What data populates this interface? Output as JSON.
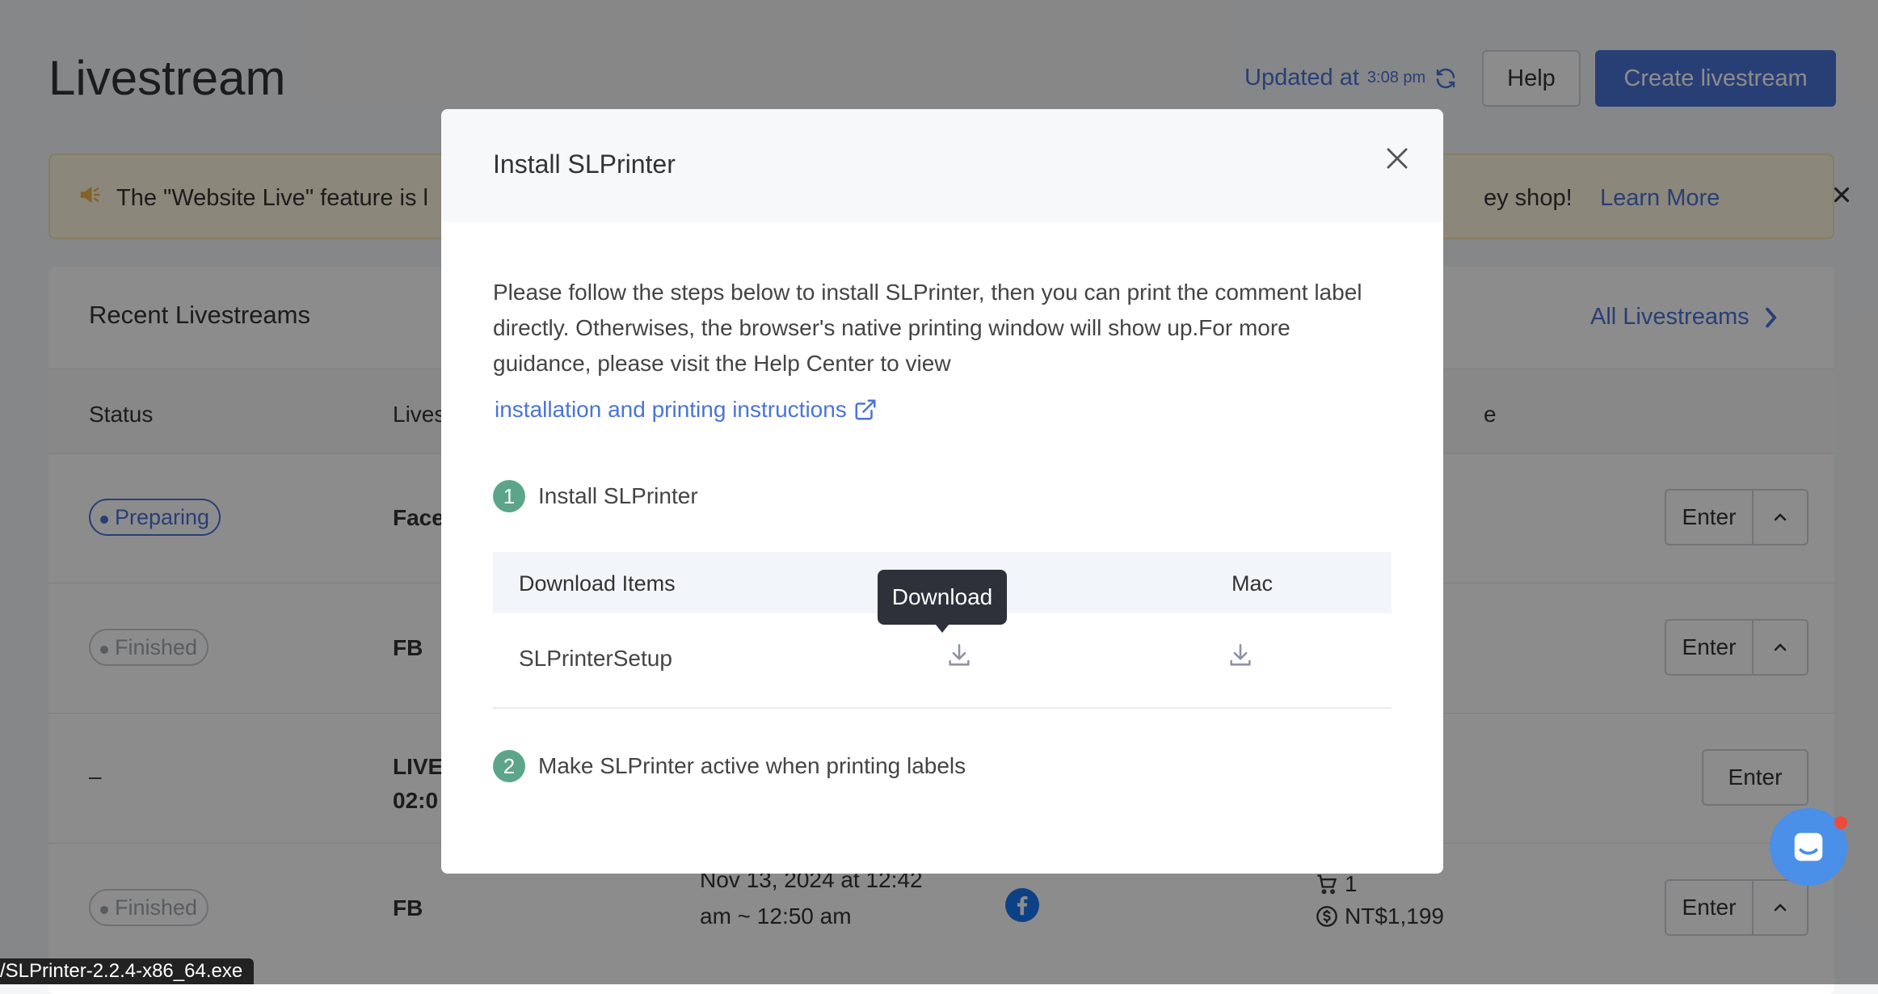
{
  "page": {
    "title": "Livestream",
    "updated_label": "Updated at",
    "updated_time": "3:08 pm",
    "help_label": "Help",
    "create_label": "Create livestream"
  },
  "banner": {
    "text_left": "The \"Website Live\" feature is l",
    "text_right": "ey shop!",
    "learn_more": "Learn More"
  },
  "recent": {
    "title": "Recent Livestreams",
    "all_link": "All Livestreams",
    "columns": [
      "Status",
      "Lives",
      "e"
    ],
    "rows": [
      {
        "status": "Preparing",
        "platform": "Face",
        "enter": "Enter"
      },
      {
        "status": "Finished",
        "platform": "FB",
        "enter": "Enter"
      },
      {
        "status": "–",
        "platform_line1": "LIVE",
        "platform_line2": "02:0",
        "enter": "Enter"
      },
      {
        "status": "Finished",
        "platform": "FB",
        "date_line1": "Nov 13, 2024 at 12:42",
        "date_line2": "am ~ 12:50 am",
        "views": "–",
        "orders": "1",
        "revenue": "NT$1,199",
        "enter": "Enter"
      }
    ]
  },
  "modal": {
    "title": "Install SLPrinter",
    "description": "Please follow the steps below to install SLPrinter, then you can print the comment label directly. Otherwises, the browser's native printing window will show up.For more guidance, please visit the Help Center to view",
    "link": "installation and printing instructions",
    "step1_num": "1",
    "step1_label": "Install SLPrinter",
    "table_col1": "Download Items",
    "table_col3": "Mac",
    "item_name": "SLPrinterSetup",
    "tooltip": "Download",
    "step2_num": "2",
    "step2_label": "Make SLPrinter active when printing labels"
  },
  "statusbar": {
    "text": "/SLPrinter-2.2.4-x86_64.exe"
  },
  "colors": {
    "accent": "#4a74d8",
    "step_green": "#5da58a",
    "banner_bg": "#fff6e0"
  }
}
